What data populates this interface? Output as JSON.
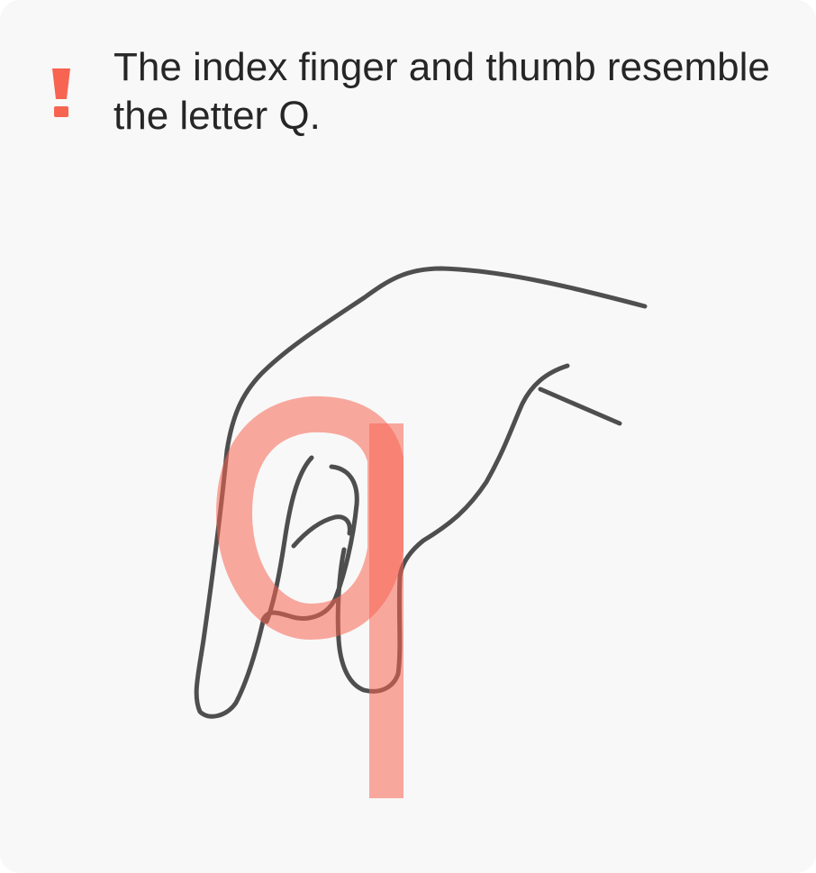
{
  "alert": {
    "icon": "exclamation-icon",
    "accent_color": "#f76452",
    "message": "The index finger and thumb resemble the letter Q."
  },
  "illustration": {
    "subject": "hand-sign-q",
    "sketch_color": "#3c3c3c",
    "letter_overlay_color": "#f76452"
  }
}
